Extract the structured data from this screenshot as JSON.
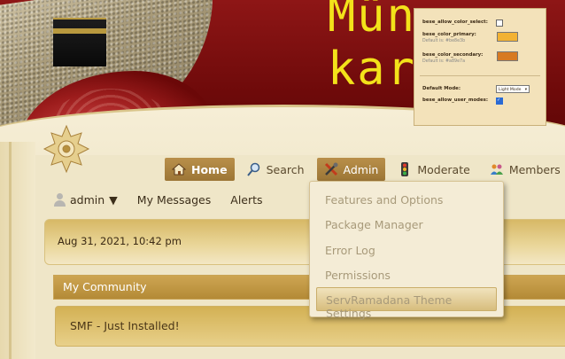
{
  "site": {
    "title": "Mün\nkard"
  },
  "settings_popup": {
    "allow_color_select_label": "bese_allow_color_select:",
    "color_primary_label": "bese_color_primary:",
    "color_primary_hint": "Default is: #be8e3b",
    "color_primary_value": "#f2b233",
    "color_secondary_label": "bese_color_secondary:",
    "color_secondary_hint": "Default is: #a89e7a",
    "color_secondary_value": "#d77a22",
    "default_mode_label": "Default Mode:",
    "default_mode_value": "Light Mode",
    "allow_user_modes_label": "bese_allow_user_modes:"
  },
  "nav": {
    "items": [
      {
        "label": "Home",
        "icon": "home-icon"
      },
      {
        "label": "Search",
        "icon": "search-icon"
      },
      {
        "label": "Admin",
        "icon": "tools-icon"
      },
      {
        "label": "Moderate",
        "icon": "traffic-light-icon"
      },
      {
        "label": "Members",
        "icon": "members-icon"
      }
    ]
  },
  "userbar": {
    "username": "admin",
    "messages": "My Messages",
    "alerts": "Alerts"
  },
  "admin_menu": {
    "items": [
      "Features and Options",
      "Package Manager",
      "Error Log",
      "Permissions",
      "ServRamadana Theme Settings"
    ]
  },
  "content": {
    "date": "Aug 31, 2021, 10:42 pm",
    "category": "My Community",
    "board": "SMF - Just Installed!"
  },
  "colors": {
    "banner": "#7a0f0f",
    "title": "#f3e21a",
    "accent": "#b98f4a",
    "page_bg": "#efe6c8"
  }
}
